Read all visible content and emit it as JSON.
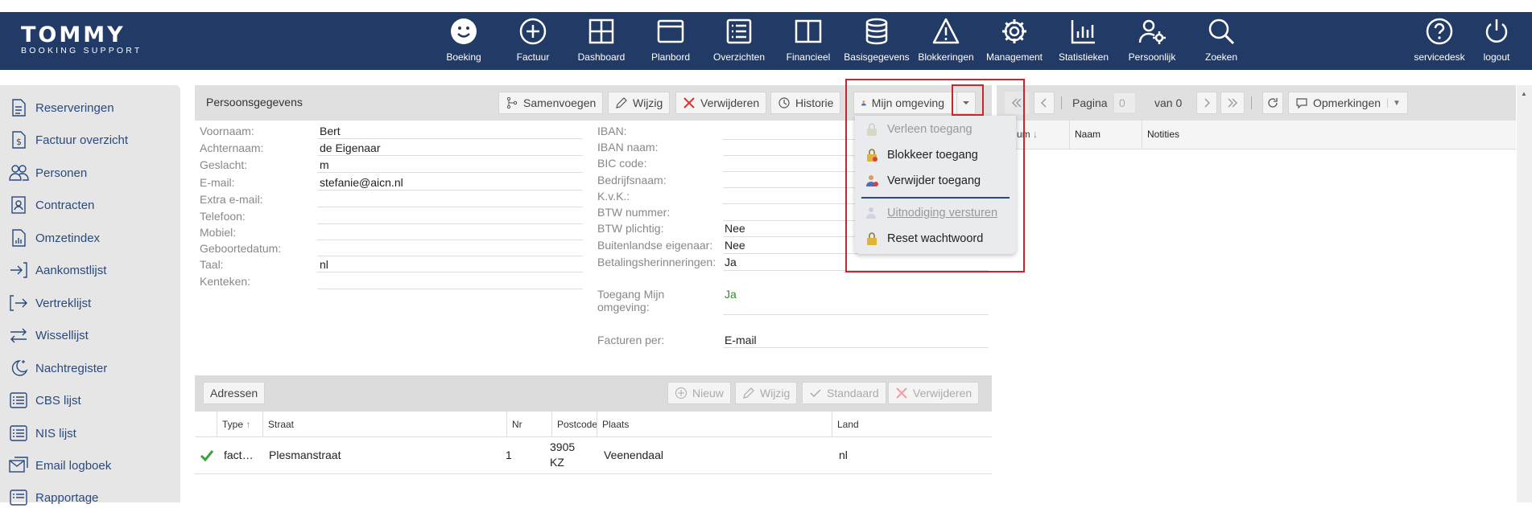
{
  "app": {
    "logo_line1": "TOMMY",
    "logo_line2": "BOOKING SUPPORT"
  },
  "nav": [
    {
      "label": "Boeking",
      "icon": "smiley-icon"
    },
    {
      "label": "Factuur",
      "icon": "plus-circle-icon"
    },
    {
      "label": "Dashboard",
      "icon": "grid-icon"
    },
    {
      "label": "Planbord",
      "icon": "board-icon"
    },
    {
      "label": "Overzichten",
      "icon": "list-icon"
    },
    {
      "label": "Financieel",
      "icon": "book-icon"
    },
    {
      "label": "Basisgegevens",
      "icon": "database-icon"
    },
    {
      "label": "Blokkeringen",
      "icon": "warning-icon"
    },
    {
      "label": "Management",
      "icon": "gear-icon"
    },
    {
      "label": "Statistieken",
      "icon": "bar-chart-icon"
    },
    {
      "label": "Persoonlijk",
      "icon": "user-gear-icon"
    },
    {
      "label": "Zoeken",
      "icon": "search-icon"
    }
  ],
  "nav_right": [
    {
      "label": "servicedesk",
      "icon": "help-icon"
    },
    {
      "label": "logout",
      "icon": "power-icon"
    }
  ],
  "sidebar": [
    {
      "label": "Reserveringen",
      "icon": "document-icon"
    },
    {
      "label": "Factuur overzicht",
      "icon": "invoice-icon"
    },
    {
      "label": "Personen",
      "icon": "people-icon"
    },
    {
      "label": "Contracten",
      "icon": "contract-icon"
    },
    {
      "label": "Omzetindex",
      "icon": "chart-doc-icon"
    },
    {
      "label": "Aankomstlijst",
      "icon": "login-icon"
    },
    {
      "label": "Vertreklijst",
      "icon": "logout-icon"
    },
    {
      "label": "Wissellijst",
      "icon": "swap-icon"
    },
    {
      "label": "Nachtregister",
      "icon": "moon-icon"
    },
    {
      "label": "CBS lijst",
      "icon": "list-box-icon"
    },
    {
      "label": "NIS lijst",
      "icon": "list-box-icon"
    },
    {
      "label": "Email logboek",
      "icon": "email-icon"
    },
    {
      "label": "Rapportage",
      "icon": "list-box-icon"
    }
  ],
  "panel": {
    "title": "Persoonsgegevens",
    "buttons": {
      "merge": "Samenvoegen",
      "edit": "Wijzig",
      "delete": "Verwijderen",
      "history": "Historie",
      "mijn": "Mijn omgeving"
    }
  },
  "person_left": [
    {
      "label": "Voornaam:",
      "value": "Bert"
    },
    {
      "label": "Achternaam:",
      "value": "de Eigenaar"
    },
    {
      "label": "Geslacht:",
      "value": "m"
    },
    {
      "label": "E-mail:",
      "value": "stefanie@aicn.nl"
    },
    {
      "label": "Extra e-mail:",
      "value": ""
    },
    {
      "label": "Telefoon:",
      "value": ""
    },
    {
      "label": "Mobiel:",
      "value": ""
    },
    {
      "label": "Geboortedatum:",
      "value": ""
    },
    {
      "label": "Taal:",
      "value": "nl"
    },
    {
      "label": "Kenteken:",
      "value": ""
    }
  ],
  "person_right": [
    {
      "label": "IBAN:",
      "value": ""
    },
    {
      "label": "IBAN naam:",
      "value": ""
    },
    {
      "label": "BIC code:",
      "value": ""
    },
    {
      "label": "Bedrijfsnaam:",
      "value": ""
    },
    {
      "label": "K.v.K.:",
      "value": ""
    },
    {
      "label": "BTW nummer:",
      "value": ""
    },
    {
      "label": "BTW plichtig:",
      "value": "Nee"
    },
    {
      "label": "Buitenlandse eigenaar:",
      "value": "Nee"
    },
    {
      "label": "Betalingsherinneringen:",
      "value": "Ja"
    }
  ],
  "toegang": {
    "label1": "Toegang Mijn",
    "label2": "omgeving:",
    "value": "Ja"
  },
  "facturen": {
    "label": "Facturen per:",
    "value": "E-mail"
  },
  "dropdown": {
    "items": [
      {
        "label": "Verleen toegang",
        "disabled": true
      },
      {
        "label": "Blokkeer toegang",
        "disabled": false
      },
      {
        "label": "Verwijder toegang",
        "disabled": false
      },
      {
        "label": "Uitnodiging versturen",
        "disabled": true
      },
      {
        "label": "Reset wachtwoord",
        "disabled": false
      }
    ]
  },
  "right": {
    "pagina": "Pagina",
    "page_value": "0",
    "van": "van 0",
    "opmerkingen": "Opmerkingen",
    "col_partial": "um",
    "col_naam": "Naam",
    "col_notities": "Notities"
  },
  "addresses": {
    "title": "Adressen",
    "buttons": {
      "new": "Nieuw",
      "edit": "Wijzig",
      "default": "Standaard",
      "delete": "Verwijderen"
    },
    "columns": [
      "Type",
      "Straat",
      "Nr",
      "Postcode",
      "Plaats",
      "Land"
    ],
    "rows": [
      {
        "type": "fact…",
        "straat": "Plesmanstraat",
        "nr": "1",
        "postcode1": "3905",
        "postcode2": "KZ",
        "plaats": "Veenendaal",
        "land": "nl"
      }
    ]
  },
  "colors": {
    "nav_bg": "#213a66",
    "accent_red": "#c9252c",
    "link_blue": "#2a4a7c",
    "green": "#2e8b2e"
  }
}
